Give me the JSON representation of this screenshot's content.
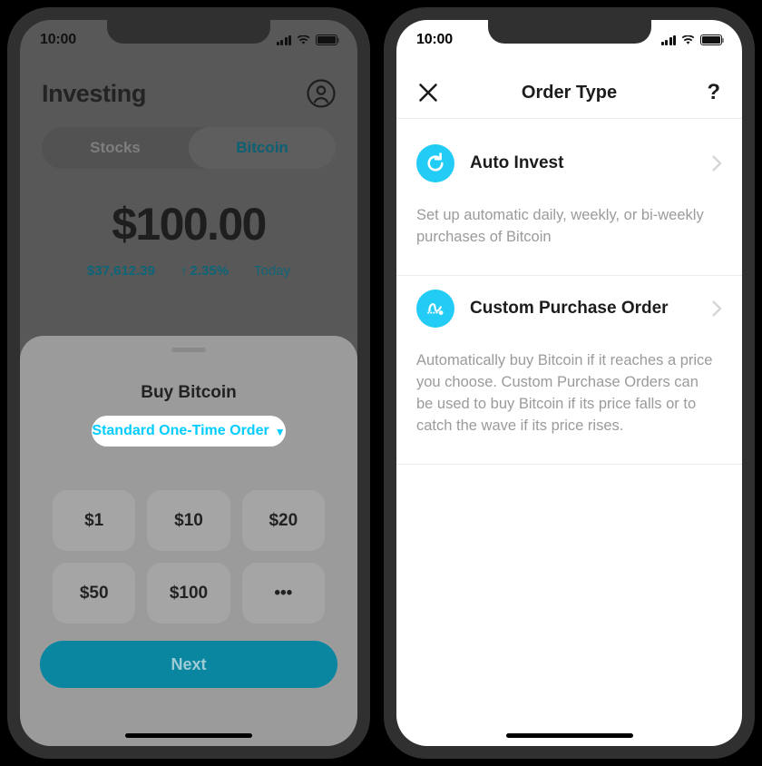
{
  "theme": {
    "page_background": "#000000",
    "frame": "#303030",
    "accent_cyan": "#22ccf5",
    "accent_teal": "#0d6578",
    "dimmed_screen": "#585858",
    "sheet": "#9b9b9b"
  },
  "left_phone": {
    "status": {
      "time": "10:00",
      "signal_icon": "signal-bars-icon",
      "wifi_icon": "wifi-icon",
      "battery_icon": "battery-icon"
    },
    "header": {
      "title": "Investing",
      "account_icon": "account-circle-icon"
    },
    "segmented": {
      "options": [
        {
          "label": "Stocks",
          "selected": false
        },
        {
          "label": "Bitcoin",
          "selected": true
        }
      ]
    },
    "balance": {
      "amount": "$100.00",
      "price": "$37,612.39",
      "change_arrow": "↑",
      "change": "2.35%",
      "period": "Today"
    },
    "sheet": {
      "grabber_icon": "sheet-grabber",
      "title": "Buy Bitcoin",
      "order_type": {
        "label": "Standard One-Time Order",
        "caret_icon": "chevron-down-icon"
      },
      "amounts": [
        "$1",
        "$10",
        "$20",
        "$50",
        "$100",
        "•••"
      ],
      "next_label": "Next"
    }
  },
  "right_phone": {
    "status": {
      "time": "10:00",
      "signal_icon": "signal-bars-icon",
      "wifi_icon": "wifi-icon",
      "battery_icon": "battery-icon"
    },
    "nav": {
      "close_icon": "close-icon",
      "title": "Order Type",
      "help_label": "?"
    },
    "options": [
      {
        "icon": "auto-invest-refresh-icon",
        "label": "Auto Invest",
        "chevron_icon": "chevron-right-icon",
        "description": "Set up automatic daily, weekly, or bi-weekly purchases of Bitcoin"
      },
      {
        "icon": "custom-purchase-order-trend-icon",
        "label": "Custom Purchase Order",
        "chevron_icon": "chevron-right-icon",
        "description": "Automatically buy Bitcoin if it reaches a price you choose. Custom Purchase Orders can be used to buy Bitcoin if its price falls or to catch the wave if its price rises."
      }
    ]
  }
}
